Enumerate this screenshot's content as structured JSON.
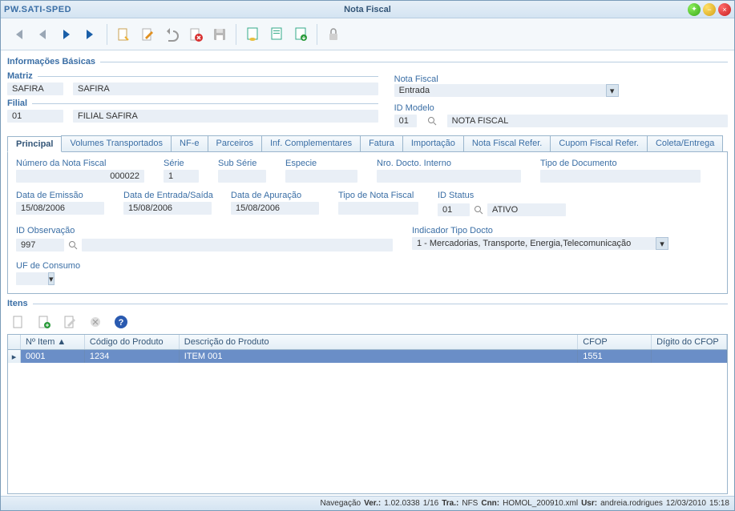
{
  "app": {
    "logo": "PW.SATI-SPED",
    "title": "Nota Fiscal"
  },
  "sections": {
    "basic": "Informações Básicas",
    "matriz": "Matriz",
    "filial": "Filial",
    "itens": "Itens"
  },
  "matriz": {
    "code": "SAFIRA",
    "name": "SAFIRA"
  },
  "filial": {
    "code": "01",
    "name": "FILIAL SAFIRA"
  },
  "notafiscal": {
    "label": "Nota Fiscal",
    "value": "Entrada",
    "idmodelo_label": "ID Modelo",
    "idmodelo_code": "01",
    "idmodelo_name": "NOTA FISCAL"
  },
  "tabs": [
    {
      "label": "Principal"
    },
    {
      "label": "Volumes Transportados"
    },
    {
      "label": "NF-e"
    },
    {
      "label": "Parceiros"
    },
    {
      "label": "Inf. Complementares"
    },
    {
      "label": "Fatura"
    },
    {
      "label": "Importação"
    },
    {
      "label": "Nota Fiscal Refer."
    },
    {
      "label": "Cupom Fiscal Refer."
    },
    {
      "label": "Coleta/Entrega"
    }
  ],
  "principal": {
    "numero_nf_label": "Número da Nota Fiscal",
    "numero_nf": "000022",
    "serie_label": "Série",
    "serie": "1",
    "subserie_label": "Sub Série",
    "subserie": "",
    "especie_label": "Especie",
    "especie": "",
    "nro_docto_label": "Nro. Docto. Interno",
    "nro_docto": "",
    "tipo_doc_label": "Tipo de Documento",
    "tipo_doc": "",
    "data_emissao_label": "Data de Emissão",
    "data_emissao": "15/08/2006",
    "data_entrada_label": "Data de Entrada/Saída",
    "data_entrada": "15/08/2006",
    "data_apuracao_label": "Data de Apuração",
    "data_apuracao": "15/08/2006",
    "tipo_nf_label": "Tipo de Nota Fiscal",
    "tipo_nf": "",
    "idstatus_label": "ID Status",
    "idstatus_code": "01",
    "idstatus_name": "ATIVO",
    "idobs_label": "ID Observação",
    "idobs_code": "997",
    "ind_tipo_label": "Indicador Tipo Docto",
    "ind_tipo": "1 - Mercadorias, Transporte, Energia,Telecomunicação",
    "uf_consumo_label": "UF de Consumo",
    "uf_consumo": ""
  },
  "grid": {
    "headers": {
      "num_item": "Nº Item",
      "codigo": "Código do Produto",
      "descricao": "Descrição do Produto",
      "cfop": "CFOP",
      "digito": "Dígito do CFOP"
    },
    "rows": [
      {
        "num_item": "0001",
        "codigo": "1234",
        "descricao": "ITEM 001",
        "cfop": "1551",
        "digito": ""
      }
    ]
  },
  "status": {
    "nav": "Navegação",
    "nav_v": "",
    "ver_l": "Ver.:",
    "ver": "1.02.0338",
    "pos": "1/16",
    "tra_l": "Tra.:",
    "tra": "NFS",
    "cnn_l": "Cnn:",
    "cnn": "HOMOL_200910.xml",
    "usr_l": "Usr:",
    "usr": "andreia.rodrigues",
    "date": "12/03/2010",
    "time": "15:18"
  }
}
